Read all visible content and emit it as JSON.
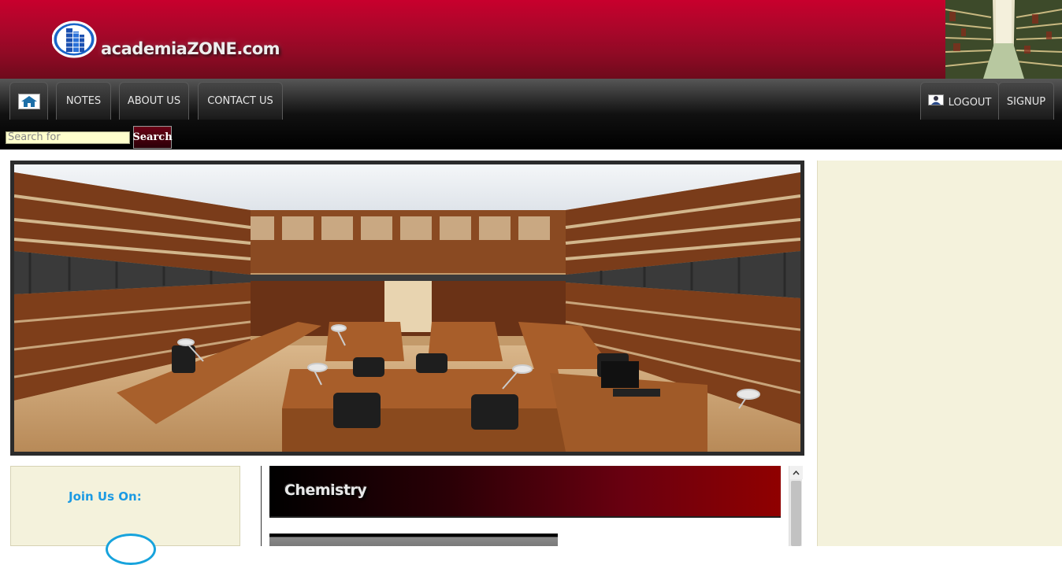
{
  "header": {
    "site_name": "academiaZONE.com",
    "brand_color": "#b8002a"
  },
  "nav": {
    "home_icon": "home-icon",
    "notes": "NOTES",
    "about": "ABOUT US",
    "contact": "CONTACT US",
    "logout": "LOGOUT",
    "signup": "SIGNUP",
    "user_icon": "user-icon"
  },
  "search": {
    "placeholder": "Search for",
    "button": "Search"
  },
  "sidebar_left": {
    "title": "Join Us On:",
    "title_color": "#1c9ae3"
  },
  "main": {
    "section_title": "Chemistry"
  }
}
